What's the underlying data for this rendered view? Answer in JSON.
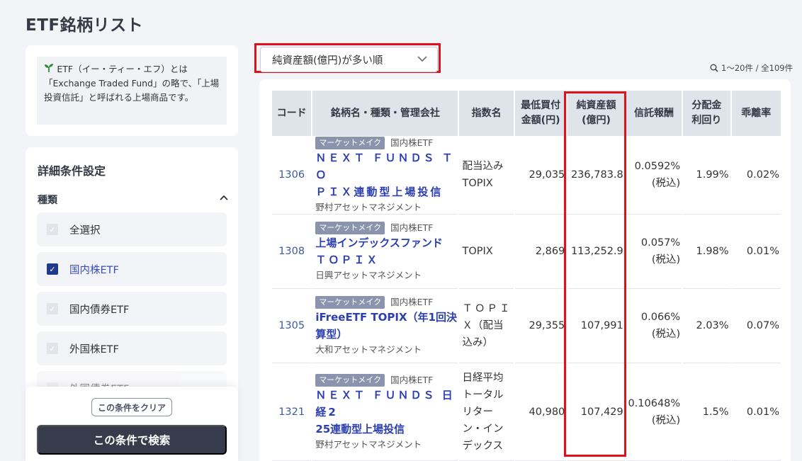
{
  "page": {
    "title": "ETF銘柄リスト"
  },
  "info": {
    "text": "ETF（イー・ティー・エフ）とは「Exchange Traded Fund」の略で、「上場投資信託」と呼ばれる上場商品です。"
  },
  "filter": {
    "title": "詳細条件設定",
    "type_label": "種類",
    "options": [
      {
        "label": "全選択",
        "checked": false
      },
      {
        "label": "国内株ETF",
        "checked": true
      },
      {
        "label": "国内債券ETF",
        "checked": false
      },
      {
        "label": "外国株ETF",
        "checked": false
      },
      {
        "label": "外国債券ETF",
        "checked": false
      }
    ],
    "clear_label": "この条件をクリア",
    "search_label": "この条件で検索"
  },
  "sort": {
    "selected": "純資産額(億円)が多い順"
  },
  "results": {
    "count_text": "1～20件 / 全109件"
  },
  "table": {
    "headers": {
      "code": "コード",
      "name": "銘柄名・種類・管理会社",
      "index": "指数名",
      "min_l1": "最低買付",
      "min_l2": "金額(円)",
      "assets_l1": "純資産額",
      "assets_l2": "(億円)",
      "fee": "信託報酬",
      "yield_l1": "分配金",
      "yield_l2": "利回り",
      "dev": "乖離率"
    },
    "rows": [
      {
        "code": "1306",
        "badge": "マーケットメイク",
        "category": "国内株ETF",
        "fund_l1": "ＮＥＸＴ ＦＵＮＤＳ ＴＯ",
        "fund_l2": "ＰＩＸ連動型上場投信",
        "manager": "野村アセットマネジメント",
        "index_l1": "配当込み",
        "index_l2": "TOPIX",
        "index_l3": "",
        "index_l4": "",
        "index_l5": "",
        "min_amount": "29,035",
        "net_assets": "236,783.8",
        "fee": "0.0592%",
        "fee_note": "(税込)",
        "yield": "1.99%",
        "deviation": "0.02%"
      },
      {
        "code": "1308",
        "badge": "マーケットメイク",
        "category": "国内株ETF",
        "fund_l1": "上場インデックスファンド",
        "fund_l2": "ＴＯＰＩＸ",
        "manager": "日興アセットマネジメント",
        "index_l1": "TOPIX",
        "index_l2": "",
        "index_l3": "",
        "index_l4": "",
        "index_l5": "",
        "min_amount": "2,869",
        "net_assets": "113,252.9",
        "fee": "0.057%",
        "fee_note": "(税込)",
        "yield": "1.98%",
        "deviation": "0.01%"
      },
      {
        "code": "1305",
        "badge": "マーケットメイク",
        "category": "国内株ETF",
        "fund_l1": "iFreeETF TOPIX（年1回決",
        "fund_l2": "算型）",
        "manager": "大和アセットマネジメント",
        "index_l1": "ＴＯＰＩ",
        "index_l2": "Ｘ（配当",
        "index_l3": "込み）",
        "index_l4": "",
        "index_l5": "",
        "min_amount": "29,355",
        "net_assets": "107,991",
        "fee": "0.066%",
        "fee_note": "(税込)",
        "yield": "2.03%",
        "deviation": "0.07%"
      },
      {
        "code": "1321",
        "badge": "マーケットメイク",
        "category": "国内株ETF",
        "fund_l1": "ＮＥＸＴ ＦＵＮＤＳ 日経2",
        "fund_l2": "25連動型上場投信",
        "manager": "野村アセットマネジメント",
        "index_l1": "日経平均",
        "index_l2": "トータル",
        "index_l3": "リター",
        "index_l4": "ン・イン",
        "index_l5": "デックス",
        "min_amount": "40,980",
        "net_assets": "107,429",
        "fee": "0.10648%",
        "fee_note": "(税込)",
        "yield": "1.5%",
        "deviation": "0.01%"
      }
    ]
  },
  "colors": {
    "accent_blue": "#2b3fb0",
    "highlight_red": "#e3101a",
    "dark_button": "#363c4c",
    "badge_gray": "#8a95ad",
    "header_gray": "#dfe3ea"
  }
}
